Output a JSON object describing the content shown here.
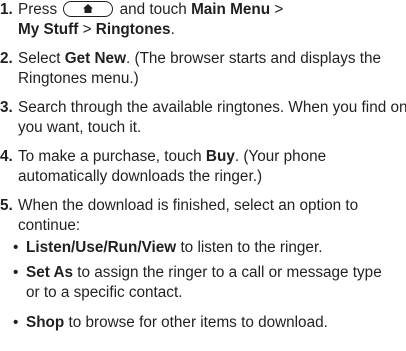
{
  "steps": [
    {
      "num": "1.",
      "text_a": "Press",
      "text_b": "and touch",
      "bold_a": "Main Menu",
      "sep1": ">",
      "bold_b": "My Stuff",
      "sep2": ">",
      "bold_c": "Ringtones",
      "end": ".",
      "icon": "home-key-icon"
    },
    {
      "num": "2.",
      "text_a": "Select",
      "bold_a": "Get New",
      "text_b": ". (The browser starts and displays the Ringtones menu.)"
    },
    {
      "num": "3.",
      "text_a": "Search through the available ringtones. When you find one you want, touch it."
    },
    {
      "num": "4.",
      "text_a": "To make a purchase, touch",
      "bold_a": "Buy",
      "text_b": ". (Your phone automatically downloads the ringer.)"
    },
    {
      "num": "5.",
      "text_a": "When the download is finished, select an option to continue:",
      "bullets": [
        {
          "dot": "•",
          "bold": "Listen/Use/Run/View",
          "text": "to listen to the ringer."
        },
        {
          "dot": "•",
          "bold": "Set As",
          "text": "to assign the ringer to a call or message type or to a specific contact."
        },
        {
          "dot": "•",
          "bold": "Shop",
          "text": "to browse for other items to download."
        }
      ]
    }
  ]
}
